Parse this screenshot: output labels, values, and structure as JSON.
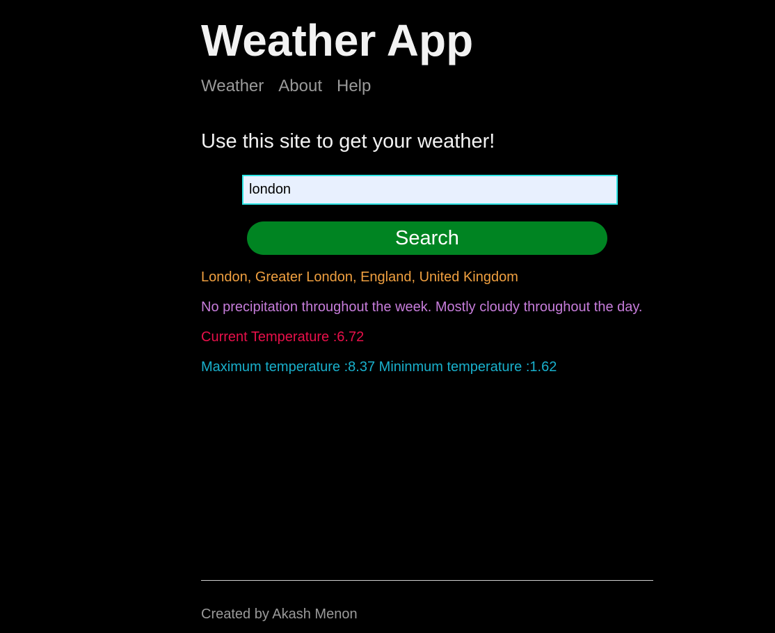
{
  "header": {
    "title": "Weather App",
    "nav": [
      {
        "label": "Weather"
      },
      {
        "label": "About"
      },
      {
        "label": "Help"
      }
    ]
  },
  "main": {
    "subtitle": "Use this site to get your weather!",
    "search": {
      "value": "london",
      "placeholder": "",
      "button_label": "Search"
    },
    "results": {
      "location": "London, Greater London, England, United Kingdom",
      "forecast": "No precipitation throughout the week. Mostly cloudy throughout the day.",
      "current": "Current Temperature :6.72",
      "minmax": "Maximum temperature :8.37 Mininmum temperature :1.62"
    }
  },
  "footer": {
    "credit": "Created by Akash Menon"
  },
  "colors": {
    "background": "#000000",
    "title": "#f2f2f2",
    "nav": "#9a9a9a",
    "input_border": "#2ee6e6",
    "input_bg": "#e8f0fe",
    "button_bg": "#008422",
    "location": "#f0a040",
    "forecast": "#c77ddb",
    "current": "#e8104a",
    "minmax": "#19b0cc",
    "footer": "#9a9a9a"
  }
}
